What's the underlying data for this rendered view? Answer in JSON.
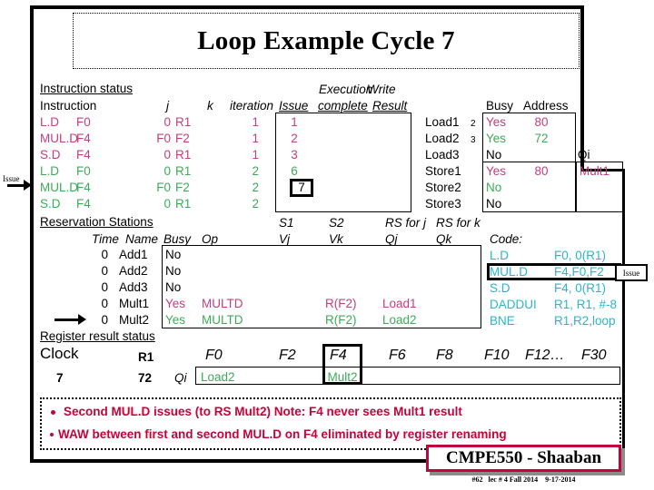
{
  "slide": {
    "title": "Loop Example Cycle 7",
    "footer_badge": "CMPE550 - Shaaban",
    "footer_sub": "#62   lec # 4 Fall 2014    9-17-2014"
  },
  "callouts": {
    "issue_left": "Issue",
    "issue_right": "Issue"
  },
  "instruction_status": {
    "section_label": "Instruction status",
    "headers": {
      "instruction": "Instruction",
      "j": "j",
      "k": "k",
      "iteration": "iteration",
      "execution": "Execution",
      "write": "Write",
      "issue": "Issue",
      "complete": "complete",
      "result": "Result"
    },
    "rows": [
      {
        "op": "L.D",
        "dest": "F0",
        "j": "0",
        "k": "R1",
        "iteration": "1",
        "issue": "1",
        "complete": "",
        "result": "",
        "color": "pink"
      },
      {
        "op": "MUL.D",
        "dest": "F4",
        "j": "F0",
        "k": "F2",
        "iteration": "1",
        "issue": "2",
        "complete": "",
        "result": "",
        "color": "pink"
      },
      {
        "op": "S.D",
        "dest": "F4",
        "j": "0",
        "k": "R1",
        "iteration": "1",
        "issue": "3",
        "complete": "",
        "result": "",
        "color": "pink"
      },
      {
        "op": "L.D",
        "dest": "F0",
        "j": "0",
        "k": "R1",
        "iteration": "2",
        "issue": "6",
        "complete": "",
        "result": "",
        "color": "green"
      },
      {
        "op": "MUL.D",
        "dest": "F4",
        "j": "F0",
        "k": "F2",
        "iteration": "2",
        "issue": "7",
        "complete": "",
        "result": "",
        "color": "green",
        "issue_highlight": true
      },
      {
        "op": "S.D",
        "dest": "F4",
        "j": "0",
        "k": "R1",
        "iteration": "2",
        "issue": "",
        "complete": "",
        "result": "",
        "color": "green"
      }
    ]
  },
  "load_store_units": {
    "headers": {
      "busy": "Busy",
      "address": "Address",
      "qi": "Qi"
    },
    "rows": [
      {
        "name": "Load1",
        "num": "2",
        "busy": "Yes",
        "address": "80",
        "qi": "",
        "color": "pink"
      },
      {
        "name": "Load2",
        "num": "3",
        "busy": "Yes",
        "address": "72",
        "qi": "",
        "color": "green"
      },
      {
        "name": "Load3",
        "num": "",
        "busy": "No",
        "address": "",
        "qi": "",
        "color": "black"
      },
      {
        "name": "Store1",
        "num": "",
        "busy": "Yes",
        "address": "80",
        "qi": "Mult1",
        "color": "pink"
      },
      {
        "name": "Store2",
        "num": "",
        "busy": "No",
        "address": "",
        "qi": "",
        "color": "green"
      },
      {
        "name": "Store3",
        "num": "",
        "busy": "No",
        "address": "",
        "qi": "",
        "color": "black"
      }
    ]
  },
  "reservation_stations": {
    "section_label": "Reservation Stations",
    "headers": {
      "time": "Time",
      "name": "Name",
      "busy": "Busy",
      "op": "Op",
      "s1": "S1",
      "vj": "Vj",
      "s2": "S2",
      "vk": "Vk",
      "rs_for_j": "RS for j",
      "qj": "Qj",
      "rs_for_k": "RS for k",
      "qk": "Qk"
    },
    "rows": [
      {
        "time": "0",
        "name": "Add1",
        "busy": "No",
        "op": "",
        "vj": "",
        "vk": "",
        "qj": "",
        "qk": "",
        "color": "black",
        "arrow": false
      },
      {
        "time": "0",
        "name": "Add2",
        "busy": "No",
        "op": "",
        "vj": "",
        "vk": "",
        "qj": "",
        "qk": "",
        "color": "black",
        "arrow": false
      },
      {
        "time": "0",
        "name": "Add3",
        "busy": "No",
        "op": "",
        "vj": "",
        "vk": "",
        "qj": "",
        "qk": "",
        "color": "black",
        "arrow": false
      },
      {
        "time": "0",
        "name": "Mult1",
        "busy": "Yes",
        "op": "MULTD",
        "vj": "",
        "vk": "R(F2)",
        "qj": "Load1",
        "qk": "",
        "color": "pink",
        "arrow": false
      },
      {
        "time": "0",
        "name": "Mult2",
        "busy": "Yes",
        "op": "MULTD",
        "vj": "",
        "vk": "R(F2)",
        "qj": "Load2",
        "qk": "",
        "color": "green",
        "arrow": true
      }
    ]
  },
  "code": {
    "label": "Code:",
    "lines": [
      {
        "op": "L.D",
        "operands": "F0, 0(R1)",
        "highlight": false
      },
      {
        "op": "MUL.D",
        "operands": "F4,F0,F2",
        "highlight": true
      },
      {
        "op": "S.D",
        "operands": "F4, 0(R1)",
        "highlight": false
      },
      {
        "op": "DADDUI",
        "operands": "R1, R1, #-8",
        "highlight": false
      },
      {
        "op": "BNE",
        "operands": "R1,R2,loop",
        "highlight": false
      }
    ]
  },
  "register_result_status": {
    "section_label": "Register result status",
    "clock_label": "Clock",
    "clock_value": "7",
    "r1_label": "R1",
    "r1_value": "72",
    "qi_label": "Qi",
    "columns": [
      {
        "reg": "F0",
        "value": "Load2",
        "highlight": false
      },
      {
        "reg": "F2",
        "value": "",
        "highlight": false
      },
      {
        "reg": "F4",
        "value": "Mult2",
        "highlight": true
      },
      {
        "reg": "F6",
        "value": "",
        "highlight": false
      },
      {
        "reg": "F8",
        "value": "",
        "highlight": false
      },
      {
        "reg": "F10",
        "value": "",
        "highlight": false
      },
      {
        "reg": "F12…",
        "value": "",
        "highlight": false
      },
      {
        "reg": "F30",
        "value": "",
        "highlight": false
      }
    ]
  },
  "notes": {
    "line1": "Second  MUL.D issues (to RS Mult2)   Note: F4 never sees  Mult1 result",
    "line2": "WAW between first and second MUL.D on F4 eliminated by register renaming"
  },
  "colors": {
    "pink": "#c0407f",
    "green": "#3faa5a",
    "cyan": "#2bb6c8",
    "crimson": "#c2043b"
  }
}
